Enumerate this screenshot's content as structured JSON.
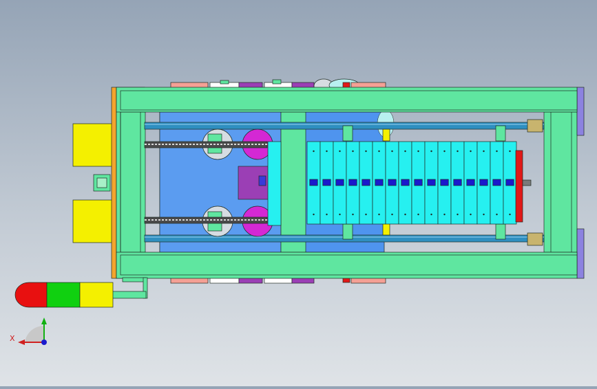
{
  "viewport": {
    "background_top": "#95a4b6",
    "background_bottom": "#dfe3e7"
  },
  "colors": {
    "frame_green": "#5fe6a0",
    "frame_edge": "#2c6e4c",
    "plate_blue": "#4f94ee",
    "rod_blue": "#2f8fc0",
    "cyan_block": "#26f0f0",
    "magenta": "#d428d4",
    "purple": "#9b3fb5",
    "yellow": "#f4f000",
    "orange": "#f3a52e",
    "salmon": "#f4a095",
    "red": "#e01818",
    "dark_blue": "#1a1acc",
    "lavender": "#8c82e0",
    "khaki": "#c8b46e",
    "signal_red": "#e81010",
    "signal_green": "#10d010",
    "signal_yellow": "#f4f000"
  },
  "triad": {
    "x_label": "X",
    "icon": "coordinate-triad-icon"
  },
  "model": {
    "name": "cad-assembly-top-view",
    "signal_tower": "signal-tower-icon",
    "cyan_block_count": 16
  }
}
